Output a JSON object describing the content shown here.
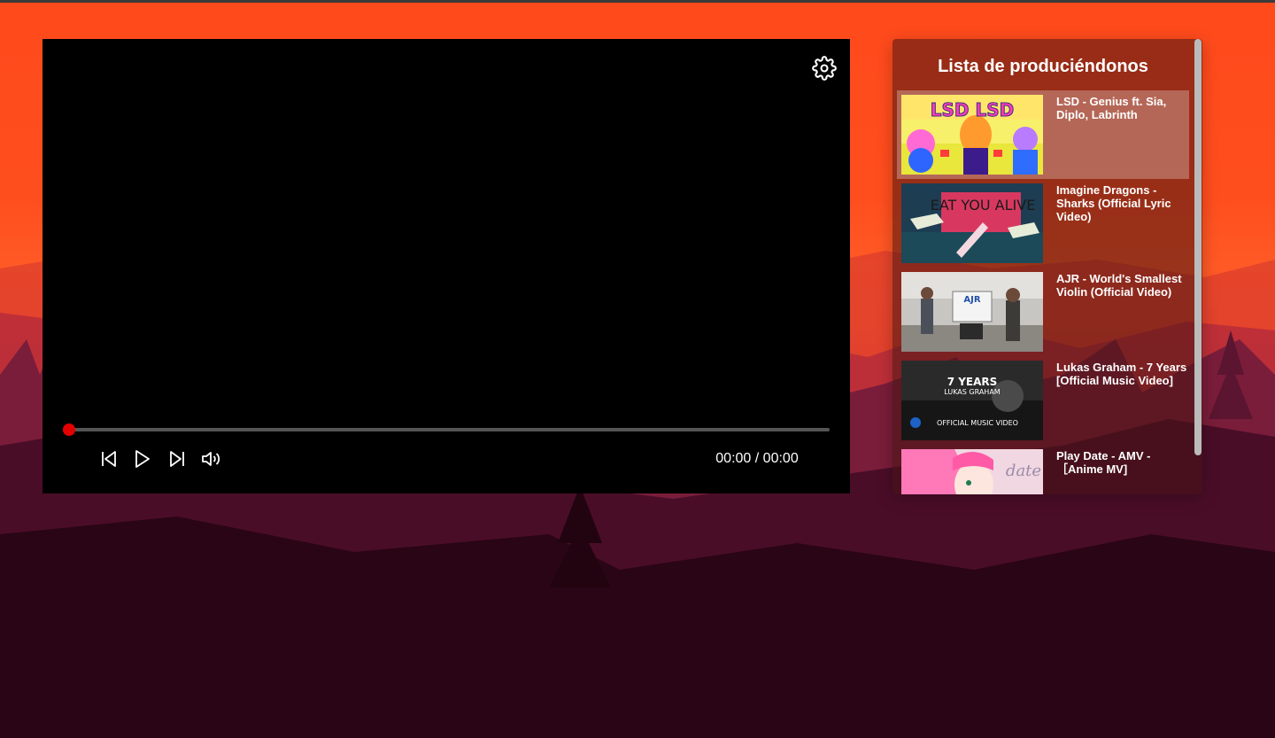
{
  "player": {
    "time_current": "00:00",
    "time_separator": " / ",
    "time_total": "00:00",
    "progress_fraction": 0.0,
    "controls": [
      "previous-icon",
      "play-icon",
      "next-icon",
      "volume-icon",
      "gear-icon"
    ]
  },
  "playlist": {
    "title": "Lista de produciéndonos",
    "active_index": 0,
    "items": [
      {
        "label": "LSD - Genius ft. Sia, Diplo, Labrinth",
        "thumb_text": "LSD LSD"
      },
      {
        "label": "Imagine Dragons - Sharks (Official Lyric Video)",
        "thumb_text": "EAT YOU ALIVE"
      },
      {
        "label": "AJR - World's Smallest Violin (Official Video)",
        "thumb_text": "AJR"
      },
      {
        "label": "Lukas Graham - 7 Years [Official Music Video]",
        "thumb_text_1": "7 YEARS",
        "thumb_text_2": "LUKAS GRAHAM",
        "thumb_text_3": "OFFICIAL MUSIC VIDEO"
      },
      {
        "label": "Play Date - AMV - ［Anime MV]",
        "thumb_text": "date"
      }
    ]
  },
  "colors": {
    "accent": "#e50000",
    "sky": "#ff4a1c",
    "panel": "#5a1a18"
  }
}
